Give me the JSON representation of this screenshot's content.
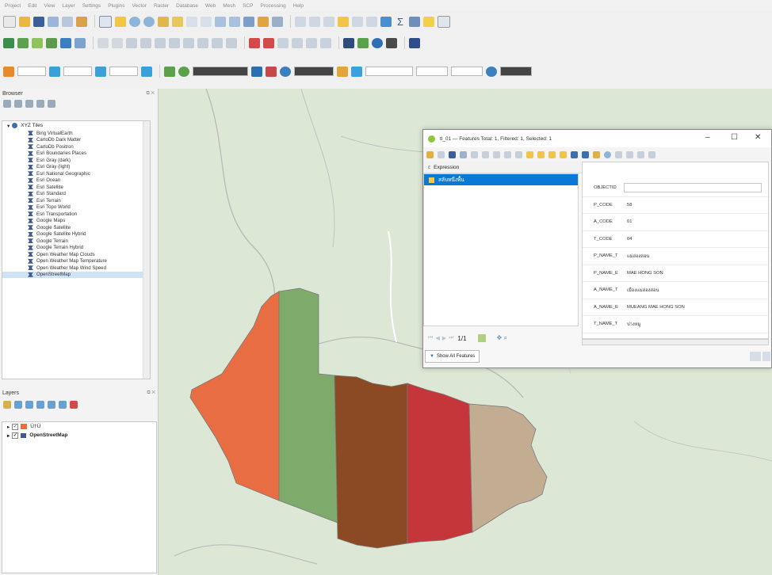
{
  "menu": [
    "Project",
    "Edit",
    "View",
    "Layer",
    "Settings",
    "Plugins",
    "Vector",
    "Raster",
    "Database",
    "Web",
    "Mesh",
    "SCP",
    "Processing",
    "Help"
  ],
  "browser_panel": {
    "title": "Browser",
    "root": "XYZ Tiles",
    "items": [
      "Bing VirtualEarth",
      "CartoDb Dark Matter",
      "CartoDb Positron",
      "Esri Boundaries Places",
      "Esri Gray (dark)",
      "Esri Gray (light)",
      "Esri National Geographic",
      "Esri Ocean",
      "Esri Satellite",
      "Esri Standard",
      "Esri Terrain",
      "Esri Topo World",
      "Esri Transportation",
      "Google Maps",
      "Google Satellite",
      "Google Satellite Hybrid",
      "Google Terrain",
      "Google Terrain Hybrid",
      "Open Weather Map Clouds",
      "Open Weather Map Temperature",
      "Open Weather Map Wind Speed",
      "OpenStreetMap"
    ],
    "selected": "OpenStreetMap"
  },
  "layers_panel": {
    "title": "Layers",
    "layers": [
      "Ù†Ù",
      "OpenStreetMap"
    ]
  },
  "dialog": {
    "title": "tl_01 — Features Total: 1, Filtered: 1, Selected: 1",
    "expression_label": "Expression",
    "feature_label": "สลับหนึ่งพื้น",
    "fields": [
      {
        "label": "OBJECTID",
        "value": ""
      },
      {
        "label": "P_CODE",
        "value": "58"
      },
      {
        "label": "A_CODE",
        "value": "01"
      },
      {
        "label": "T_CODE",
        "value": "04"
      },
      {
        "label": "P_NAME_T",
        "value": "แม่ฮ่องสอน"
      },
      {
        "label": "P_NAME_E",
        "value": "MAE HONG SON"
      },
      {
        "label": "A_NAME_T",
        "value": "เมืองแม่ฮ่องสอน"
      },
      {
        "label": "A_NAME_E",
        "value": "MUEANG MAE HONG SON"
      },
      {
        "label": "T_NAME_T",
        "value": "ปางหมู"
      }
    ],
    "nav_text": "1/1",
    "show_all": "Show All Features",
    "minimize": "–",
    "maximize": "☐",
    "close": "✕"
  },
  "colors": {
    "poly1": "#e96d42",
    "poly2": "#7eaa6c",
    "poly3": "#8c4a24",
    "poly4": "#c4363a",
    "poly5": "#c3ad92",
    "map_bg": "#dce7d5"
  }
}
